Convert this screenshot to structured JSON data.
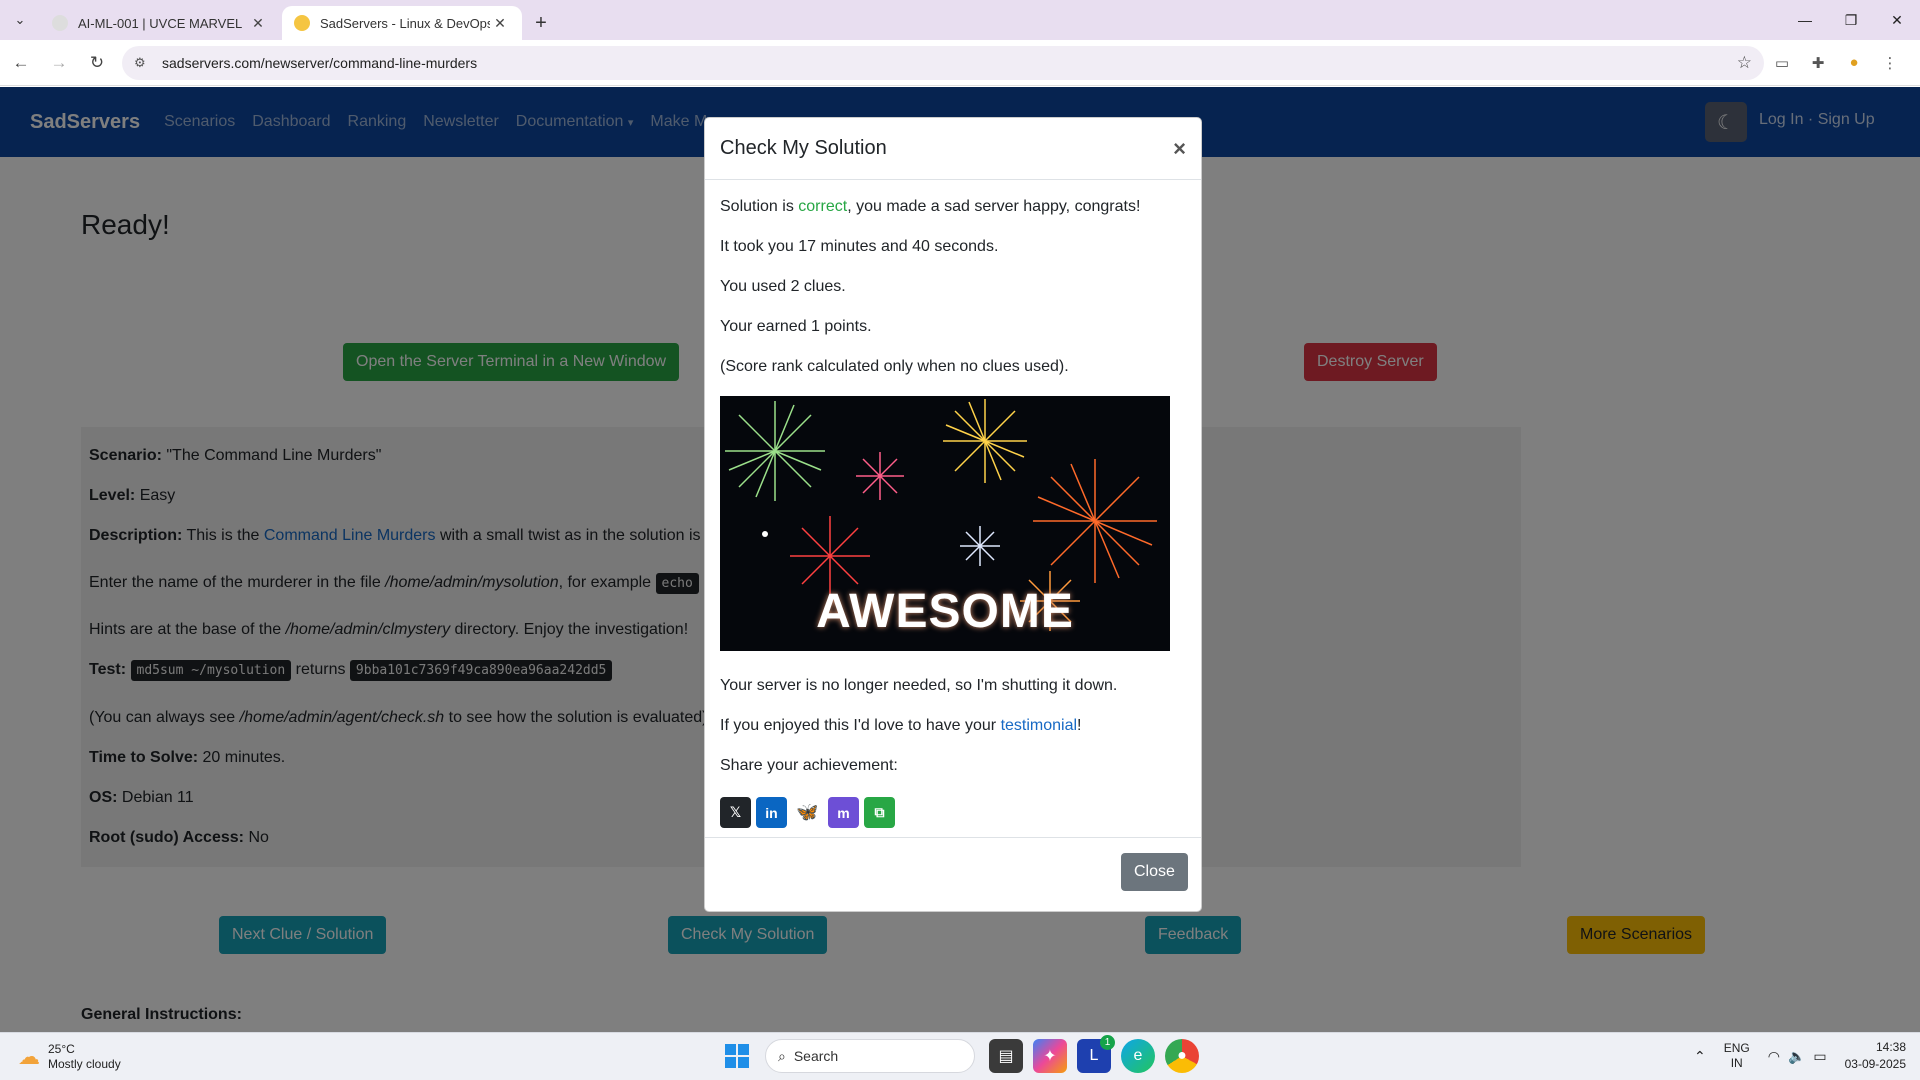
{
  "browser": {
    "tabs": [
      {
        "title": "AI-ML-001 | UVCE MARVEL",
        "active": false
      },
      {
        "title": "SadServers - Linux & DevOps Tr",
        "active": true
      }
    ],
    "url": "sadservers.com/newserver/command-line-murders"
  },
  "site_nav": {
    "brand": "SadServers",
    "links": [
      "Scenarios",
      "Dashboard",
      "Ranking",
      "Newsletter",
      "Documentation",
      "Make Mo"
    ],
    "auth": "Log In · Sign Up"
  },
  "page": {
    "heading": "Ready!",
    "open_terminal_button": "Open the Server Terminal in a New Window",
    "destroy_button": "Destroy Server",
    "scenario_label": "Scenario:",
    "scenario_value": "\"The Command Line Murders\"",
    "level_label": "Level:",
    "level_value": "Easy",
    "description_label": "Description:",
    "description_pre": "This is the",
    "description_link": "Command Line Murders",
    "description_post": "with a small twist as in the solution is c",
    "enter_pre": "Enter the name of the murderer in the file",
    "enter_path": "/home/admin/mysolution",
    "enter_mid": ", for example",
    "enter_code": "echo",
    "hints_pre": "Hints are at the base of the",
    "hints_path": "/home/admin/clmystery",
    "hints_post": "directory. Enjoy the investigation!",
    "test_label": "Test:",
    "test_code": "md5sum ~/mysolution",
    "test_returns": "returns",
    "test_hash": "9bba101c7369f49ca890ea96aa242dd5",
    "check_pre": "(You can always see",
    "check_path": "/home/admin/agent/check.sh",
    "check_post": "to see how the solution is evaluated).",
    "time_label": "Time to Solve:",
    "time_value": "20 minutes.",
    "os_label": "OS:",
    "os_value": "Debian 11",
    "root_label": "Root (sudo) Access:",
    "root_value": "No",
    "next_clue_button": "Next Clue / Solution",
    "check_solution_button": "Check My Solution",
    "feedback_button": "Feedback",
    "more_scenarios_button": "More Scenarios",
    "general_instructions": "General Instructions:"
  },
  "modal": {
    "title": "Check My Solution",
    "result_pre": "Solution is",
    "result_word": "correct",
    "result_post": ", you made a sad server happy, congrats!",
    "time_taken": "It took you 17 minutes and 40 seconds.",
    "clues": "You used 2 clues.",
    "points": "Your earned 1 points.",
    "score_note": "(Score rank calculated only when no clues used).",
    "image_text": "AWESOME",
    "shutdown": "Your server is no longer needed, so I'm shutting it down.",
    "enjoy_pre": "If you enjoyed this I'd love to have your",
    "enjoy_link": "testimonial",
    "enjoy_post": "!",
    "share_label": "Share your achievement:",
    "share_icons": [
      "x-icon",
      "linkedin-icon",
      "bluesky-icon",
      "mastodon-icon",
      "copy-icon"
    ],
    "close_button": "Close"
  },
  "taskbar": {
    "temperature": "25°C",
    "weather": "Mostly cloudy",
    "search_placeholder": "Search",
    "lang_top": "ENG",
    "lang_bottom": "IN",
    "time": "14:38",
    "date": "03-09-2025",
    "badge": "1"
  },
  "colors": {
    "navbar": "#0d47a1",
    "green": "#28a745",
    "red": "#dc3545",
    "teal": "#17a2b8",
    "yellow": "#ffc107"
  }
}
